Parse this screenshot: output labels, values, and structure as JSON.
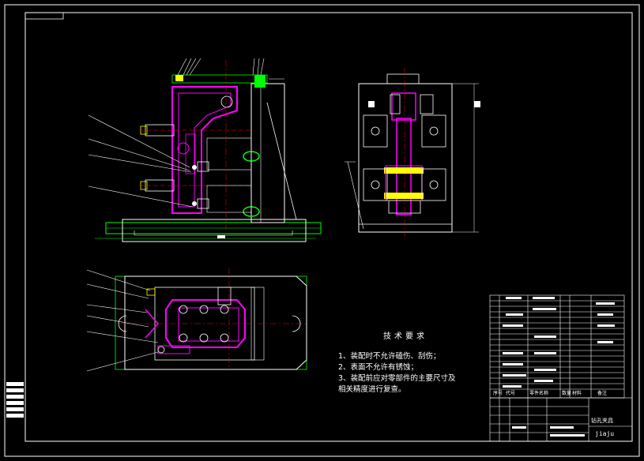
{
  "drawing": {
    "background": "#000000",
    "line_color": "#ffffff",
    "part_color": "#ff00ff",
    "accent_color": "#00ff00",
    "dimension_color": "#ff0000"
  },
  "tech_requirements": {
    "title": "技术要求",
    "items": [
      "1、装配时不允许磕伤、刮伤；",
      "2、表面不允许有锈蚀；",
      "3、装配前应对零部件的主要尺寸及",
      "相关精度进行复查。"
    ]
  },
  "title_block": {
    "drawing_name": "钻孔夹具",
    "drawing_no": "jiaju"
  },
  "bom": {
    "headers": [
      "序号",
      "代号",
      "零件名称",
      "数量",
      "材料",
      "备注"
    ]
  }
}
